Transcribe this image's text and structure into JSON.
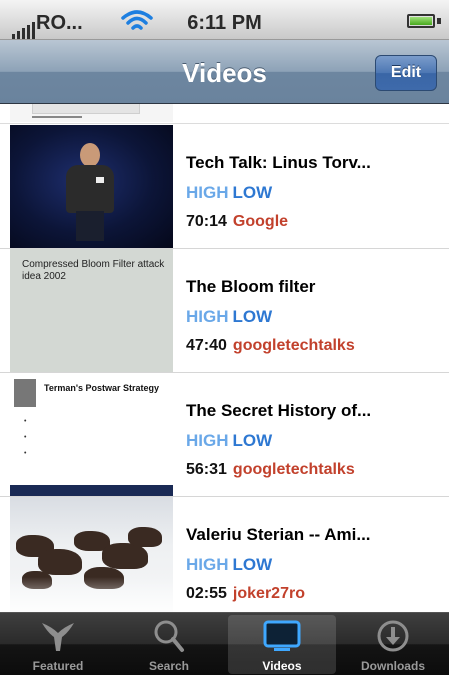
{
  "status_bar": {
    "carrier": "RO...",
    "time": "6:11 PM"
  },
  "nav": {
    "title": "Videos",
    "edit_label": "Edit"
  },
  "list": {
    "rows": [
      {
        "title": "Tech Talk: Linus Torv...",
        "high": "HIGH",
        "low": "LOW",
        "duration": "70:14",
        "author": "Google"
      },
      {
        "title": "The Bloom filter",
        "high": "HIGH",
        "low": "LOW",
        "duration": "47:40",
        "author": "googletechtalks",
        "thumb_text": "Compressed Bloom Filter attack idea 2002"
      },
      {
        "title": "The Secret History of...",
        "high": "HIGH",
        "low": "LOW",
        "duration": "56:31",
        "author": "googletechtalks",
        "thumb_heading": "Terman's Postwar Strategy"
      },
      {
        "title": "Valeriu Sterian -- Ami...",
        "high": "HIGH",
        "low": "LOW",
        "duration": "02:55",
        "author": "joker27ro"
      }
    ]
  },
  "tab_bar": {
    "tabs": [
      {
        "label": "Featured",
        "icon": "featured-icon"
      },
      {
        "label": "Search",
        "icon": "search-icon"
      },
      {
        "label": "Videos",
        "icon": "videos-icon",
        "active": true
      },
      {
        "label": "Downloads",
        "icon": "downloads-icon"
      }
    ]
  },
  "colors": {
    "high_quality": "#6aa8e8",
    "low_quality": "#2e78d2",
    "author": "#c2412c",
    "nav_accent": "#6d86a0"
  }
}
